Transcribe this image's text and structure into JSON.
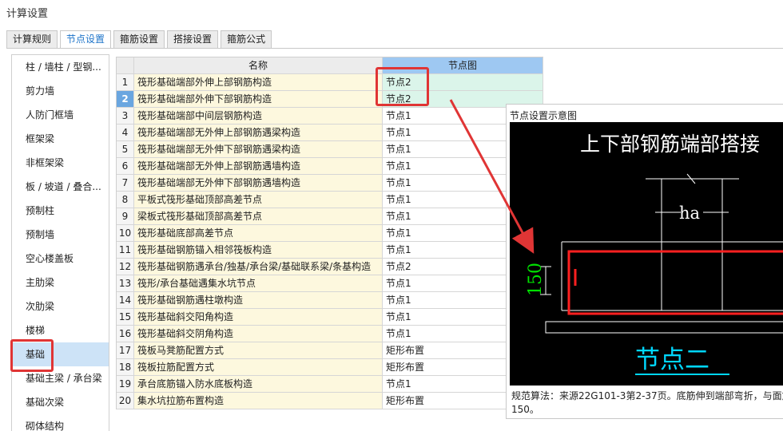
{
  "window": {
    "title": "计算设置"
  },
  "tabs": [
    {
      "label": "计算规则",
      "active": false
    },
    {
      "label": "节点设置",
      "active": true
    },
    {
      "label": "箍筋设置",
      "active": false
    },
    {
      "label": "搭接设置",
      "active": false
    },
    {
      "label": "箍筋公式",
      "active": false
    }
  ],
  "sidebar": {
    "items": [
      {
        "label": "柱 / 墙柱 / 型钢..."
      },
      {
        "label": "剪力墙"
      },
      {
        "label": "人防门框墙"
      },
      {
        "label": "框架梁"
      },
      {
        "label": "非框架梁"
      },
      {
        "label": "板 / 坡道 / 叠合..."
      },
      {
        "label": "预制柱"
      },
      {
        "label": "预制墙"
      },
      {
        "label": "空心楼盖板"
      },
      {
        "label": "主肋梁"
      },
      {
        "label": "次肋梁"
      },
      {
        "label": "楼梯"
      },
      {
        "label": "基础"
      },
      {
        "label": "基础主梁 / 承台梁"
      },
      {
        "label": "基础次梁"
      },
      {
        "label": "砌体结构"
      }
    ],
    "selected": "基础"
  },
  "grid": {
    "headers": {
      "name": "名称",
      "node": "节点图"
    },
    "rows": [
      {
        "idx": "1",
        "name": "筏形基础端部外伸上部钢筋构造",
        "node": "节点2"
      },
      {
        "idx": "2",
        "name": "筏形基础端部外伸下部钢筋构造",
        "node": "节点2"
      },
      {
        "idx": "3",
        "name": "筏形基础端部中间层钢筋构造",
        "node": "节点1"
      },
      {
        "idx": "4",
        "name": "筏形基础端部无外伸上部钢筋遇梁构造",
        "node": "节点1"
      },
      {
        "idx": "5",
        "name": "筏形基础端部无外伸下部钢筋遇梁构造",
        "node": "节点1"
      },
      {
        "idx": "6",
        "name": "筏形基础端部无外伸上部钢筋遇墙构造",
        "node": "节点1"
      },
      {
        "idx": "7",
        "name": "筏形基础端部无外伸下部钢筋遇墙构造",
        "node": "节点1"
      },
      {
        "idx": "8",
        "name": "平板式筏形基础顶部高差节点",
        "node": "节点1"
      },
      {
        "idx": "9",
        "name": "梁板式筏形基础顶部高差节点",
        "node": "节点1"
      },
      {
        "idx": "10",
        "name": "筏形基础底部高差节点",
        "node": "节点1"
      },
      {
        "idx": "11",
        "name": "筏形基础钢筋锚入相邻筏板构造",
        "node": "节点1"
      },
      {
        "idx": "12",
        "name": "筏形基础钢筋遇承台/独基/承台梁/基础联系梁/条基构造",
        "node": "节点2"
      },
      {
        "idx": "13",
        "name": "筏形/承台基础遇集水坑节点",
        "node": "节点1"
      },
      {
        "idx": "14",
        "name": "筏形基础钢筋遇柱墩构造",
        "node": "节点1"
      },
      {
        "idx": "15",
        "name": "筏形基础斜交阳角构造",
        "node": "节点1"
      },
      {
        "idx": "16",
        "name": "筏形基础斜交阴角构造",
        "node": "节点1"
      },
      {
        "idx": "17",
        "name": "筏板马凳筋配置方式",
        "node": "矩形布置"
      },
      {
        "idx": "18",
        "name": "筏板拉筋配置方式",
        "node": "矩形布置"
      },
      {
        "idx": "19",
        "name": "承台底筋锚入防水底板构造",
        "node": "节点1"
      },
      {
        "idx": "20",
        "name": "集水坑拉筋布置构造",
        "node": "矩形布置"
      }
    ]
  },
  "preview": {
    "title": "节点设置示意图",
    "diagram": {
      "heading": "上下部钢筋端部搭接",
      "dim_ha": "ha",
      "dim_150": "150",
      "caption": "节点二"
    },
    "note_line1": "规范算法：来源22G101-3第2-37页。底筋伸到端部弯折，与面筋",
    "note_line2": "150。"
  },
  "colors": {
    "accent": "#1e74c9",
    "highlight_red": "#e03535",
    "node_header": "#9ec8f2",
    "diagram_green": "#00e000",
    "diagram_red": "#ff2020",
    "diagram_cyan": "#00d7ff"
  }
}
